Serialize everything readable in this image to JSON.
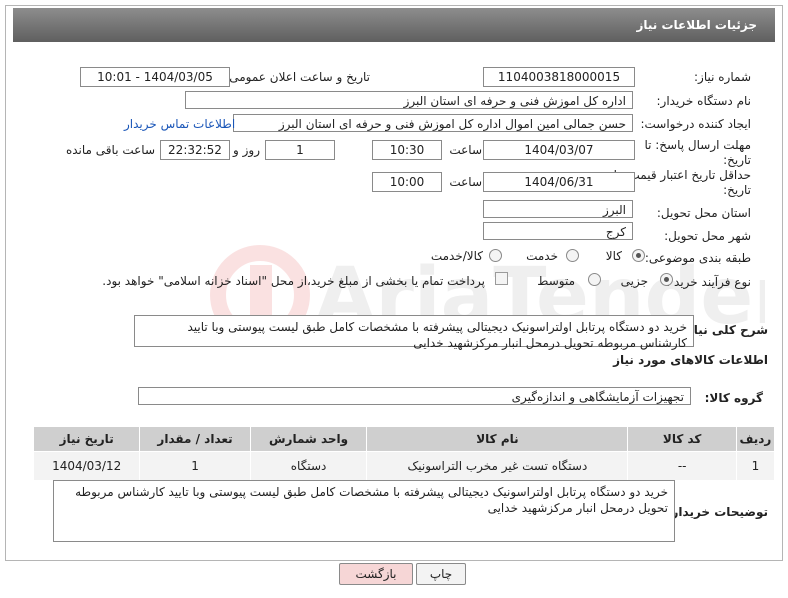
{
  "header": {
    "title": "جزئیات اطلاعات نیاز"
  },
  "form": {
    "need_number_label": "شماره نیاز:",
    "need_number": "1104003818000015",
    "announce_label": "تاریخ و ساعت اعلان عمومی:",
    "announce_value": "1404/03/05 - 10:01",
    "buyer_label": "نام دستگاه خریدار:",
    "buyer_value": "اداره کل اموزش فنی و حرفه ای استان البرز",
    "creator_label": "ایجاد کننده درخواست:",
    "creator_value": "حسن جمالی امین اموال اداره کل اموزش فنی و حرفه ای استان البرز",
    "contact_link": "اطلاعات تماس خریدار",
    "deadline_label": "مهلت ارسال پاسخ: تا تاریخ:",
    "deadline_date": "1404/03/07",
    "time_label": "ساعت",
    "deadline_time": "10:30",
    "days_value": "1",
    "days_label": "روز و",
    "remaining_value": "22:32:52",
    "remaining_label": "ساعت باقی مانده",
    "validity_label": "حداقل تاریخ اعتبار قیمت: تا تاریخ:",
    "validity_date": "1404/06/31",
    "validity_time": "10:00",
    "province_label": "استان محل تحویل:",
    "province_value": "البرز",
    "city_label": "شهر محل تحویل:",
    "city_value": "کرج",
    "category_label": "طبقه بندی موضوعی:",
    "category_options": [
      "کالا",
      "خدمت",
      "کالا/خدمت"
    ],
    "category_selected": "کالا",
    "process_label": "نوع فرآیند خرید :",
    "process_options": [
      "جزیی",
      "متوسط"
    ],
    "process_selected": "جزیی",
    "payment_note": "پرداخت تمام یا بخشی از مبلغ خرید،از محل \"اسناد خزانه اسلامی\" خواهد بود.",
    "description_label": "شرح کلی نیاز:",
    "description_value": "خرید دو دستگاه پرتابل اولتراسونیک دیجیتالی پیشرفته با مشخصات کامل طبق لیست پیوستی وبا تایید کارشناس مربوطه تحویل درمحل انبار مرکزشهید خدایی"
  },
  "goods": {
    "section_title": "اطلاعات کالاهای مورد نیاز",
    "group_label": "گروه کالا:",
    "group_value": "تجهیزات آزمایشگاهی و اندازه‌گیری",
    "columns": [
      "ردیف",
      "کد کالا",
      "نام کالا",
      "واحد شمارش",
      "تعداد / مقدار",
      "تاریخ نیاز"
    ],
    "rows": [
      {
        "index": "1",
        "code": "--",
        "name": "دستگاه تست غیر مخرب التراسونیک",
        "unit": "دستگاه",
        "qty": "1",
        "date": "1404/03/12"
      }
    ]
  },
  "buyer_notes": {
    "label": "توضیحات خریدار:",
    "value": "خرید دو دستگاه پرتابل اولتراسونیک دیجیتالی پیشرفته با مشخصات کامل طبق لیست پیوستی وبا تایید کارشناس مربوطه تحویل درمحل انبار مرکزشهید خدایی"
  },
  "buttons": {
    "print": "چاپ",
    "back": "بازگشت"
  },
  "colors": {
    "header_bg": "#6f6f6f",
    "link": "#1a56b8",
    "back_button_bg": "#f6d6d6"
  }
}
